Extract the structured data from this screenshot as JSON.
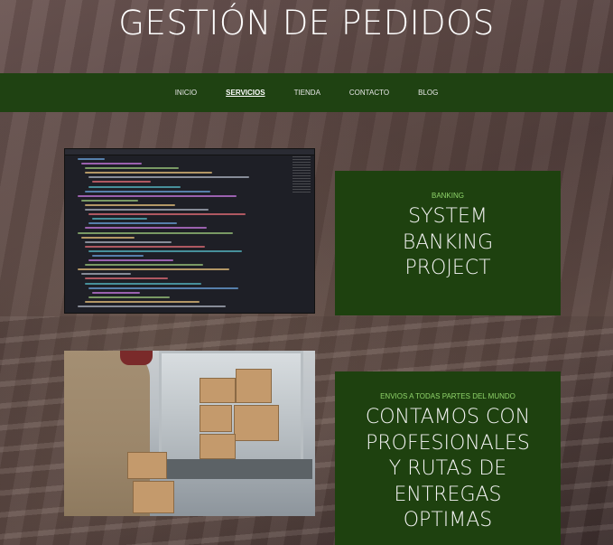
{
  "header": {
    "title": "GESTIÓN DE PEDIDOS"
  },
  "nav": {
    "items": [
      {
        "label": "INICIO",
        "active": false
      },
      {
        "label": "SERVICIOS",
        "active": true
      },
      {
        "label": "TIENDA",
        "active": false
      },
      {
        "label": "CONTACTO",
        "active": false
      },
      {
        "label": "BLOG",
        "active": false
      }
    ]
  },
  "cards": [
    {
      "subtitle": "BANKING",
      "title": "SYSTEM\nBANKING\nPROJECT"
    },
    {
      "subtitle": "ENVIOS A TODAS PARTES DEL MUNDO",
      "title": "CONTAMOS CON\nPROFESIONALES\nY RUTAS DE\nENTREGAS\nOPTIMAS"
    }
  ],
  "colors": {
    "nav_background": "#1f4212",
    "card_background": "#1e410f",
    "card_subtitle": "#8fd46a",
    "title_text": "#ffffff"
  }
}
